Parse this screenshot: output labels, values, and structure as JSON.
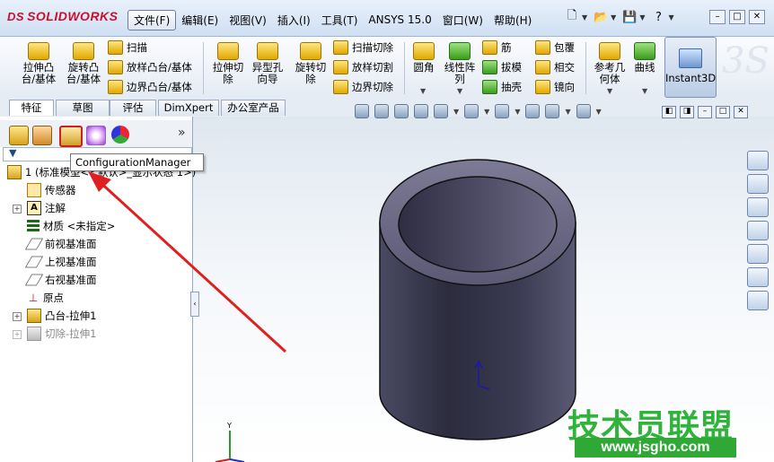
{
  "app": {
    "logo_text": "SOLIDWORKS",
    "logo_mark": "DS"
  },
  "menu": [
    "文件(F)",
    "编辑(E)",
    "视图(V)",
    "插入(I)",
    "工具(T)",
    "ANSYS 15.0",
    "窗口(W)",
    "帮助(H)"
  ],
  "ribbon": {
    "extrude_boss": "拉伸凸\n台/基体",
    "revolve_boss": "旋转凸\n台/基体",
    "sweep": "扫描",
    "loft_boss": "放样凸台/基体",
    "boundary_boss": "边界凸台/基体",
    "extrude_cut": "拉伸切\n除",
    "hole_wizard": "异型孔\n向导",
    "revolve_cut": "旋转切\n除",
    "sweep_cut": "扫描切除",
    "loft_cut": "放样切割",
    "boundary_cut": "边界切除",
    "fillet": "圆角",
    "linear_pattern": "线性阵\n列",
    "rib": "筋",
    "draft": "拔模",
    "shell": "抽壳",
    "wrap": "包覆",
    "intersect": "相交",
    "mirror": "镜向",
    "ref_geometry": "参考几\n何体",
    "curves": "曲线",
    "instant3d": "Instant3D"
  },
  "command_tabs": [
    "特征",
    "草图",
    "评估",
    "DimXpert",
    "办公室产品"
  ],
  "feature_tree": {
    "root": "1 (标准模型<<默认>_显示状态 1>)",
    "items": [
      "传感器",
      "注解",
      "材质 <未指定>",
      "前视基准面",
      "上视基准面",
      "右视基准面",
      "原点",
      "凸台-拉伸1",
      "切除-拉伸1"
    ]
  },
  "tooltip": "ConfigurationManager",
  "watermark": {
    "cn": "技术员联盟",
    "url": "www.jsgho.com"
  },
  "colors": {
    "accent_red": "#c8102e",
    "annotation_arrow": "#e02020",
    "cylinder": "#3a3a4f",
    "watermark_green": "#2fb33a"
  }
}
